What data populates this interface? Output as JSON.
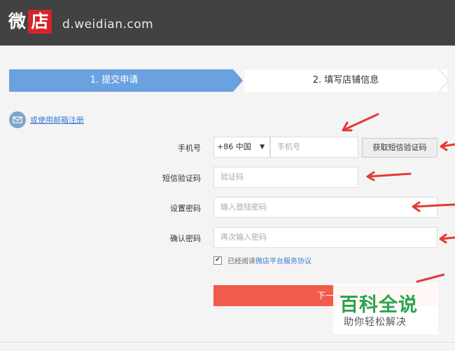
{
  "header": {
    "logo_char1": "微",
    "logo_char2": "店",
    "domain": "d.weidian.com"
  },
  "steps": [
    {
      "label": "1. 提交申请",
      "active": true
    },
    {
      "label": "2. 填写店铺信息",
      "active": false
    }
  ],
  "email_link": "或使用邮箱注册",
  "form": {
    "phone_label": "手机号",
    "country_code": "+86 中国",
    "phone_placeholder": "手机号",
    "sms_button": "获取短信验证码",
    "code_label": "短信验证码",
    "code_placeholder": "验证码",
    "password_label": "设置密码",
    "password_placeholder": "输入登陆密码",
    "confirm_label": "确认密码",
    "confirm_placeholder": "再次输入密码",
    "agree_prefix": "已经阅读",
    "agree_terms": "微店平台服务协议",
    "next_button": "下一"
  },
  "watermark": {
    "title": "百科全说",
    "subtitle": "助你轻松解决"
  },
  "colors": {
    "header_bg": "#424242",
    "brand_red": "#d8232a",
    "step_active": "#6aa1e0",
    "link_blue": "#3a7bd5",
    "button_red": "#f25a4a",
    "annotation_arrow": "#e53935",
    "watermark_green": "#2ba44b"
  }
}
